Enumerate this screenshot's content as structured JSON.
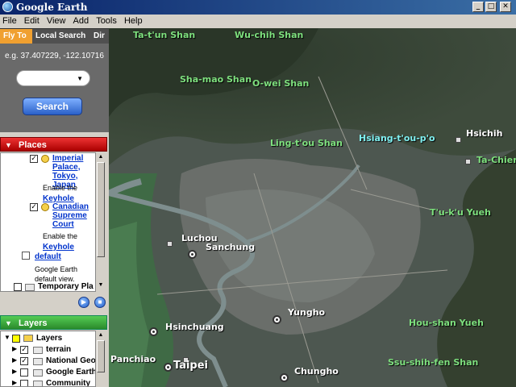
{
  "window": {
    "title": "Google Earth"
  },
  "menu": [
    "File",
    "Edit",
    "View",
    "Add",
    "Tools",
    "Help"
  ],
  "tabs": [
    {
      "label": "Fly To",
      "active": true
    },
    {
      "label": "Local Search",
      "active": false
    },
    {
      "label": "Dir",
      "active": false
    }
  ],
  "flyto": {
    "example": "e.g. 37.407229, -122.10716",
    "search_label": "Search"
  },
  "places": {
    "header": "Places",
    "items": {
      "imperial_link": "Imperial Palace, Tokyo, Japan",
      "enable_text_1": "Enable the",
      "keyhole_link_1": "Keyhole",
      "canadian_link": "Canadian Supreme Court",
      "enable_text_2": "Enable the",
      "keyhole_link_2": "Keyhole",
      "default_link": "default",
      "default_desc": "Google Earth default view.",
      "temporary": "Temporary Pla"
    }
  },
  "layers": {
    "header": "Layers",
    "items": [
      {
        "label": "Layers",
        "checked": false
      },
      {
        "label": "terrain",
        "checked": true
      },
      {
        "label": "National Geo",
        "checked": true
      },
      {
        "label": "Google Earth",
        "checked": false
      },
      {
        "label": "Community",
        "checked": false
      }
    ]
  },
  "map": {
    "mountain_labels": {
      "tatun": "Ta-t'un Shan",
      "wuchih": "Wu-chih Shan",
      "shamao": "Sha-mao Shan",
      "owei": "O-wei Shan",
      "lingtou": "Ling-t'ou Shan",
      "xiangtoupo": "Hsiang-t'ou-p'o",
      "tachien": "Ta-Chien S",
      "tukuyueh": "T'u-k'u Yueh",
      "houshan": "Hou-shan Yueh",
      "ssushih": "Ssu-shih-fen Shan"
    },
    "city_labels": {
      "hsichih": "Hsichih",
      "luchou": "Luchou",
      "sanchung": "Sanchung",
      "yungho": "Yungho",
      "hsinchuang": "Hsinchuang",
      "panchiao": "Panchiao",
      "taipei": "Taipei",
      "chungho": "Chungho"
    }
  },
  "colors": {
    "places_header": "#cc1111",
    "layers_header": "#2a8a2a",
    "active_tab": "#f0a030",
    "mountain_label": "#7ee07e",
    "highlight_label": "#7ff0f0",
    "link": "#0033cc"
  }
}
